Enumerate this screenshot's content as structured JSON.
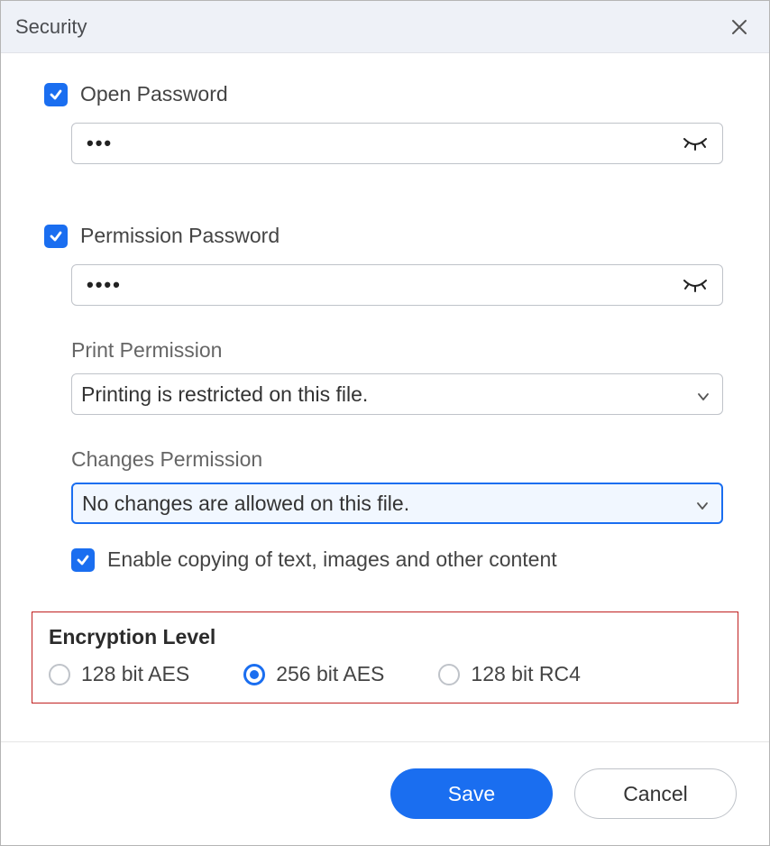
{
  "dialog": {
    "title": "Security"
  },
  "open_password": {
    "label": "Open Password",
    "checked": true,
    "value": "•••"
  },
  "permission_password": {
    "label": "Permission Password",
    "checked": true,
    "value": "••••"
  },
  "print_permission": {
    "label": "Print Permission",
    "value": "Printing is restricted on this file."
  },
  "changes_permission": {
    "label": "Changes Permission",
    "value": "No changes are allowed on this file."
  },
  "enable_copy": {
    "label": "Enable copying of text, images and other content",
    "checked": true
  },
  "encryption": {
    "title": "Encryption Level",
    "options": [
      {
        "label": "128 bit AES",
        "selected": false
      },
      {
        "label": "256 bit AES",
        "selected": true
      },
      {
        "label": "128 bit RC4",
        "selected": false
      }
    ]
  },
  "buttons": {
    "save": "Save",
    "cancel": "Cancel"
  }
}
